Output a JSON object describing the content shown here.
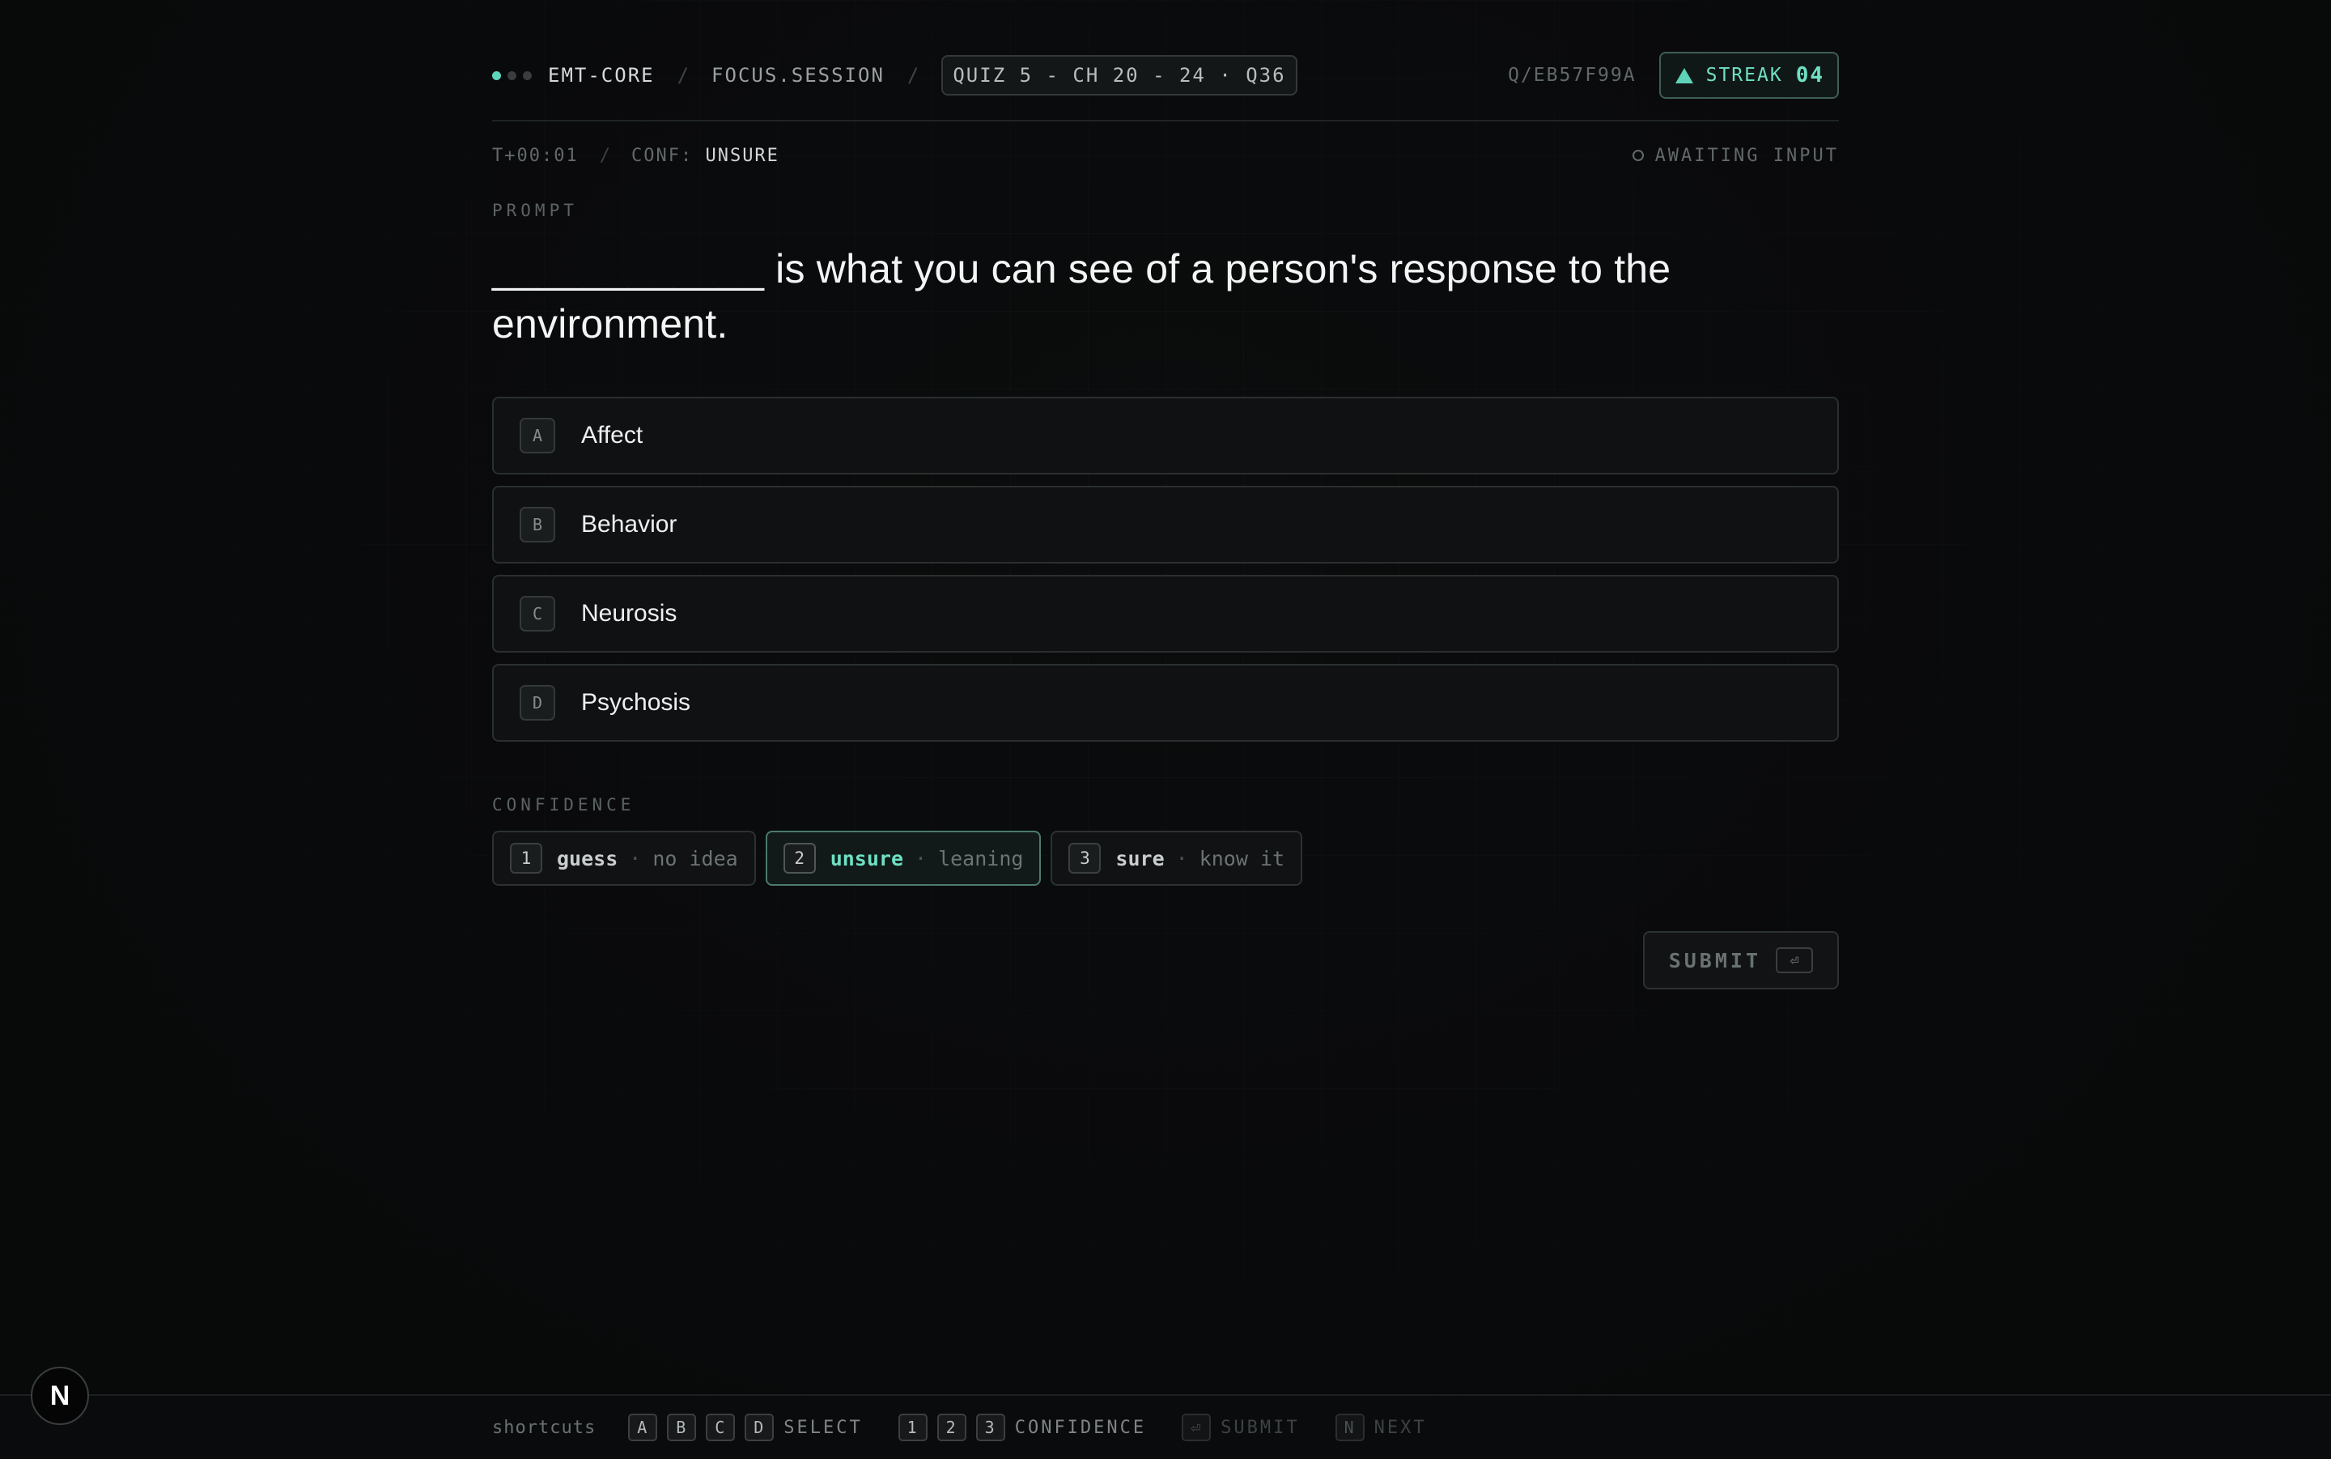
{
  "header": {
    "app": "EMT-CORE",
    "session": "FOCUS.SESSION",
    "quiz_chip": "QUIZ 5 - CH 20 - 24 · Q36",
    "question_id": "Q/EB57F99A",
    "streak_label": "STREAK",
    "streak_count": "04"
  },
  "status": {
    "timer": "T+00:01",
    "conf_label": "CONF:",
    "conf_value": "UNSURE",
    "state": "AWAITING INPUT"
  },
  "prompt": {
    "label": "PROMPT",
    "text": "____________ is what you can see of a person's response to the environment."
  },
  "options": [
    {
      "key": "A",
      "text": "Affect"
    },
    {
      "key": "B",
      "text": "Behavior"
    },
    {
      "key": "C",
      "text": "Neurosis"
    },
    {
      "key": "D",
      "text": "Psychosis"
    }
  ],
  "confidence": {
    "label": "CONFIDENCE",
    "selected": "unsure",
    "levels": [
      {
        "key": "1",
        "name": "guess",
        "desc": "no idea"
      },
      {
        "key": "2",
        "name": "unsure",
        "desc": "leaning"
      },
      {
        "key": "3",
        "name": "sure",
        "desc": "know it"
      }
    ]
  },
  "submit": {
    "label": "SUBMIT",
    "key_glyph": "⏎"
  },
  "footer": {
    "shortcuts_label": "shortcuts",
    "select_keys": [
      "A",
      "B",
      "C",
      "D"
    ],
    "select_label": "SELECT",
    "confidence_keys": [
      "1",
      "2",
      "3"
    ],
    "confidence_label": "CONFIDENCE",
    "submit_key": "⏎",
    "submit_label": "SUBMIT",
    "next_key": "N",
    "next_label": "NEXT"
  },
  "badge": {
    "letter": "N"
  },
  "colors": {
    "accent": "#5fd3b8",
    "background": "#0b0c0d"
  }
}
